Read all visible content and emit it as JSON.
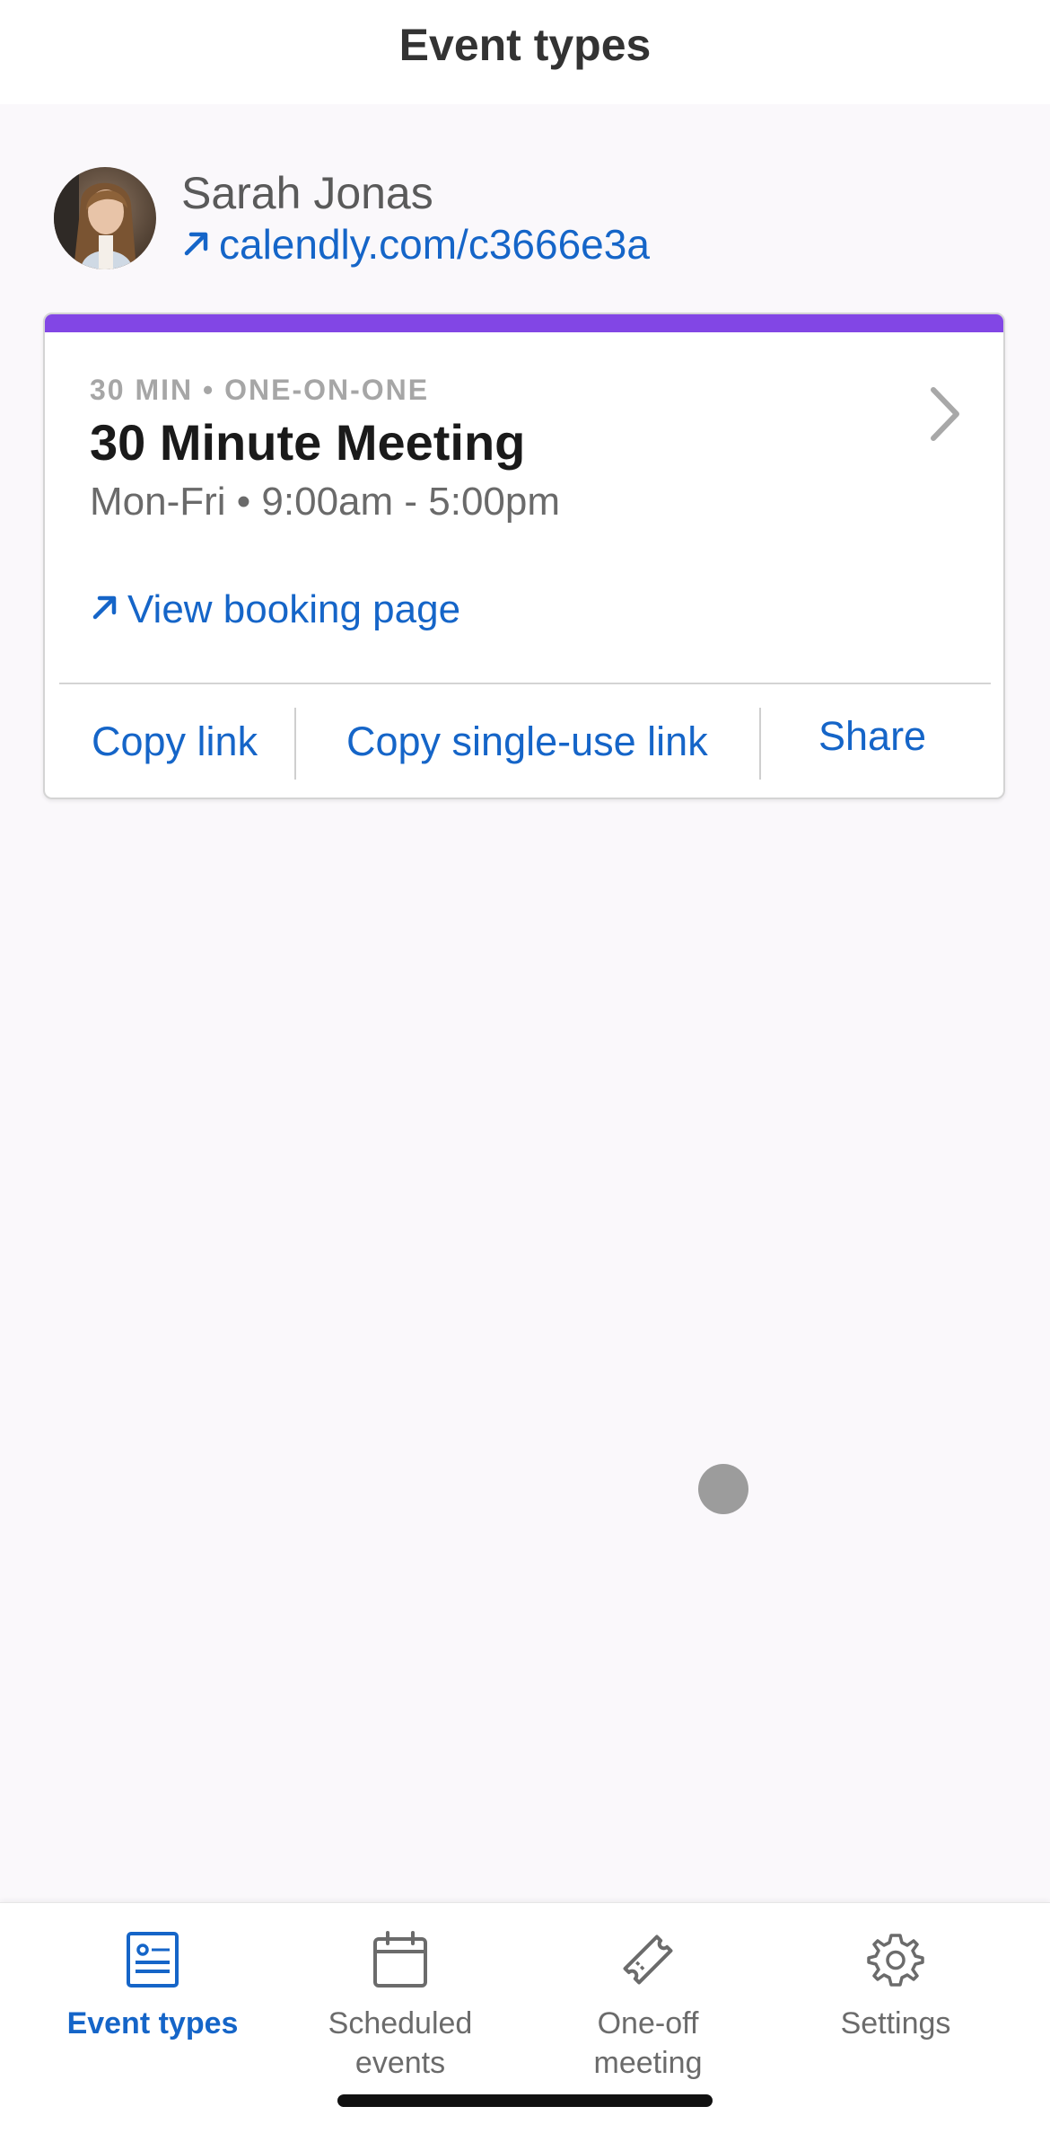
{
  "header": {
    "title": "Event types"
  },
  "profile": {
    "name": "Sarah Jonas",
    "link_text": "calendly.com/c3666e3a",
    "link_icon": "arrow-up-right-icon"
  },
  "event_card": {
    "accent_color": "#8246e5",
    "meta": "30 MIN • ONE-ON-ONE",
    "title": "30 Minute Meeting",
    "hours": "Mon-Fri • 9:00am - 5:00pm",
    "view_booking_label": "View booking page",
    "actions": {
      "copy_link": "Copy link",
      "copy_single_use_link": "Copy single-use link",
      "share": "Share"
    }
  },
  "tabbar": {
    "tabs": [
      {
        "label": "Event types",
        "icon": "event-types-icon",
        "active": true
      },
      {
        "label": "Scheduled\nevents",
        "icon": "calendar-icon",
        "active": false
      },
      {
        "label": "One-off\nmeeting",
        "icon": "ticket-icon",
        "active": false
      },
      {
        "label": "Settings",
        "icon": "gear-icon",
        "active": false
      }
    ]
  },
  "colors": {
    "link_blue": "#1565c8",
    "accent_purple": "#8246e5",
    "background": "#faf8fb"
  }
}
